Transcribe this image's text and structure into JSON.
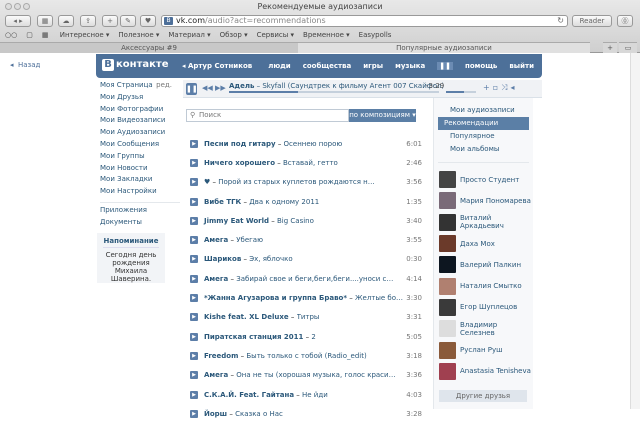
{
  "browser": {
    "title": "Рекомендуемые аудиозаписи",
    "url_domain": "vk.com",
    "url_path": "/audio?act=recommendations",
    "reader": "Reader",
    "bookmarks": [
      "Интересное ▾",
      "Полезное ▾",
      "Материал ▾",
      "Обзор ▾",
      "Сервисы ▾",
      "Временное ▾",
      "Easypolls"
    ],
    "tabs": [
      "Аксессуары #9",
      "Популярные аудиозаписи"
    ]
  },
  "back": "Назад",
  "header": {
    "logo": "ВКонтакте",
    "logo_letter": "В",
    "logo_text": "контакте",
    "user": "◂ Артур Сотников",
    "nav": [
      "люди",
      "сообщества",
      "игры",
      "музыка",
      "помощь",
      "выйти"
    ]
  },
  "player": {
    "artist": "Адель",
    "title": "Skyfall (Саундтрек к фильму Агент 007 Скайфол)",
    "time": "-3:29",
    "progress": 0.33,
    "volume": 0.6
  },
  "left_menu": {
    "edit": "ред.",
    "items": [
      "Моя Страница",
      "Мои Друзья",
      "Мои Фотографии",
      "Мои Видеозаписи",
      "Мои Аудиозаписи",
      "Мои Сообщения",
      "Мои Группы",
      "Мои Новости",
      "Мои Закладки",
      "Мои Настройки"
    ],
    "extra": [
      "Приложения",
      "Документы"
    ]
  },
  "reminder": {
    "title": "Напоминание",
    "text": "Сегодня день рождения Михаила Шаверина."
  },
  "search": {
    "placeholder": "Поиск",
    "button": "по композициям ▾"
  },
  "tracks": [
    {
      "artist": "Песни под гитару",
      "title": "Осеннею порою",
      "dur": "6:01"
    },
    {
      "artist": "Ничего хорошего",
      "title": "Вставай, гетто",
      "dur": "2:46"
    },
    {
      "artist": "♥",
      "title": "Порой из старых куплетов рождаются новые песни...",
      "dur": "3:56"
    },
    {
      "artist": "Вибе ТГК",
      "title": "Два к одному 2011",
      "dur": "1:35"
    },
    {
      "artist": "Jimmy Eat World",
      "title": "Big Casino",
      "dur": "3:40"
    },
    {
      "artist": "Амега",
      "title": "Убегаю",
      "dur": "3:55"
    },
    {
      "artist": "Шариков",
      "title": "Эх, яблочко",
      "dur": "0:30"
    },
    {
      "artist": "Амега",
      "title": "Забирай свое и беги,беги,беги....уноси свои ноги,ног...",
      "dur": "4:14"
    },
    {
      "artist": "*Жанна Агузарова и группа Браво*",
      "title": "Желтые ботинки",
      "dur": "3:30"
    },
    {
      "artist": "Kishe feat. XL Deluxe",
      "title": "Титры",
      "dur": "3:31"
    },
    {
      "artist": "Пиратская станция 2011",
      "title": "2",
      "dur": "5:05"
    },
    {
      "artist": "Freedom",
      "title": "Быть только с тобой (Radio_edit)",
      "dur": "3:18"
    },
    {
      "artist": "Амега",
      "title": "Она не ты (хорошая музыка, голос красивый)",
      "dur": "3:36"
    },
    {
      "artist": "С.К.А.Й. Feat. Гайтана",
      "title": "Не йди",
      "dur": "4:03"
    },
    {
      "artist": "Йорш",
      "title": "Сказка о Нас",
      "dur": "3:28"
    }
  ],
  "right_menu": [
    "Мои аудиозаписи",
    "Рекомендации",
    "Популярное",
    "Мои альбомы"
  ],
  "friends": [
    "Просто Студент",
    "Мария Пономарева",
    "Виталий Аркадьевич",
    "Даха Мох",
    "Валерий Палкин",
    "Наталия Смытко",
    "Егор Шуплецов",
    "Владимир Селезнев",
    "Руслан Руш",
    "Anastasia Tenisheva"
  ],
  "friend_colors": [
    "#444",
    "#7a6a78",
    "#333",
    "#6b3a2a",
    "#0d1620",
    "#b08070",
    "#3a3a3a",
    "#ddd",
    "#8a5a3a",
    "#a04050"
  ],
  "other_friends": "Другие друзья"
}
